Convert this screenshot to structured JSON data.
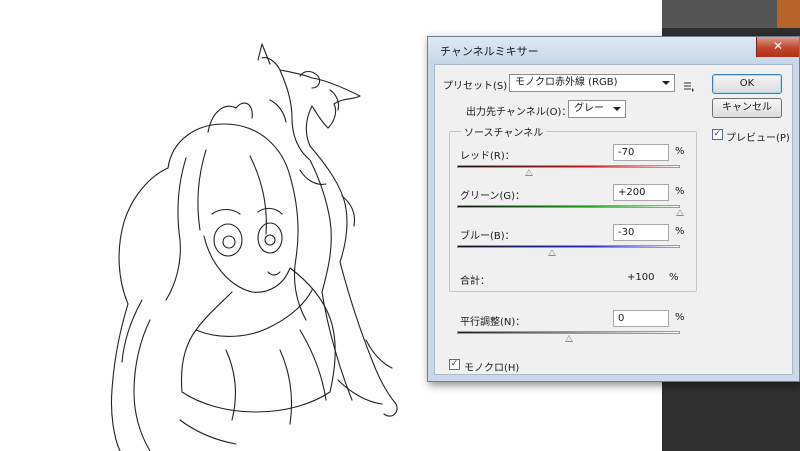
{
  "dialog": {
    "title": "チャンネルミキサー",
    "close_glyph": "✕",
    "preset_label": "プリセット(S)：",
    "preset_value": "モノクロ赤外線 (RGB)",
    "preset_menu_icon": "menu-list-icon",
    "output_channel_label": "出力先チャンネル(O)：",
    "output_channel_value": "グレー",
    "source_channels_title": "ソースチャンネル",
    "channels": [
      {
        "label": "レッド(R)：",
        "value": "-70",
        "percent": "%",
        "level": -70,
        "color_end": "#c81e1e"
      },
      {
        "label": "グリーン(G)：",
        "value": "+200",
        "percent": "%",
        "level": 200,
        "color_end": "#1fa81f"
      },
      {
        "label": "ブルー(B)：",
        "value": "-30",
        "percent": "%",
        "level": -30,
        "color_end": "#2424c8"
      }
    ],
    "total_label": "合計：",
    "total_value": "+100",
    "total_percent": "%",
    "constant_label": "平行調整(N)：",
    "constant_value": "0",
    "constant_percent": "%",
    "constant_level": 0,
    "monochrome_label": "モノクロ(H)",
    "monochrome_checked": true,
    "ok_label": "OK",
    "cancel_label": "キャンセル",
    "preview_label": "プレビュー(P)",
    "preview_checked": true
  },
  "colors": {
    "dialog_frame": "#c9d9ea",
    "close_button": "#c0432c",
    "app_background": "#2f2f2f"
  }
}
